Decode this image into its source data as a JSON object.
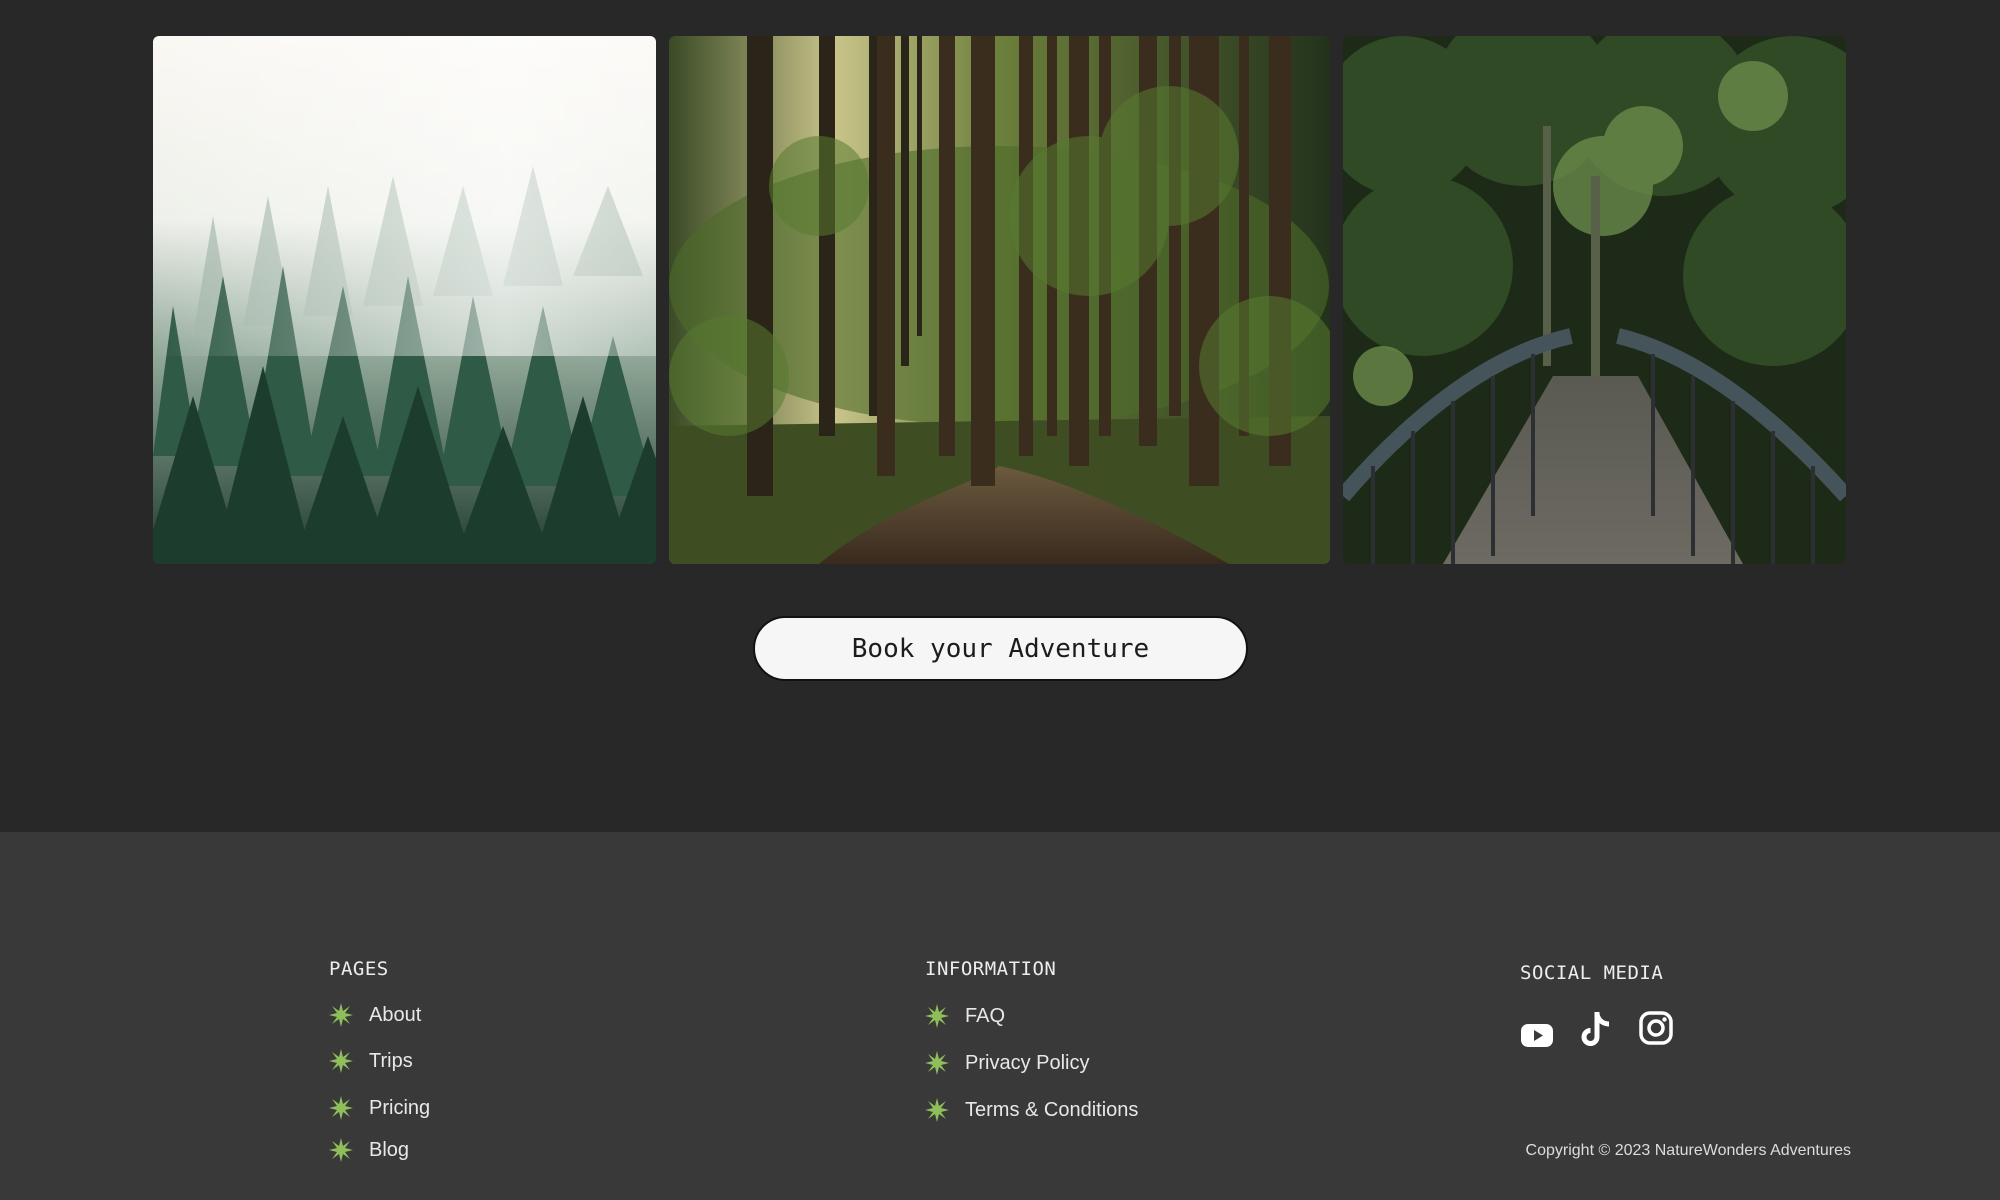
{
  "gallery": {
    "images": [
      {
        "subject": "misty pine forest"
      },
      {
        "subject": "forest trail"
      },
      {
        "subject": "footbridge through jungle"
      }
    ]
  },
  "cta": {
    "label": "Book your Adventure"
  },
  "footer": {
    "pages": {
      "heading": "PAGES",
      "links": [
        "About",
        "Trips",
        "Pricing",
        "Blog"
      ]
    },
    "information": {
      "heading": "INFORMATION",
      "links": [
        "FAQ",
        "Privacy Policy",
        "Terms & Conditions"
      ]
    },
    "social": {
      "heading": "SOCIAL MEDIA",
      "icons": [
        "youtube-icon",
        "tiktok-icon",
        "instagram-icon"
      ]
    },
    "copyright": "Copyright © 2023 NatureWonders Adventures"
  },
  "colors": {
    "background": "#282828",
    "footer": "#393939",
    "accent_star": "#8fbf5a",
    "button": "#f6f6f6"
  }
}
